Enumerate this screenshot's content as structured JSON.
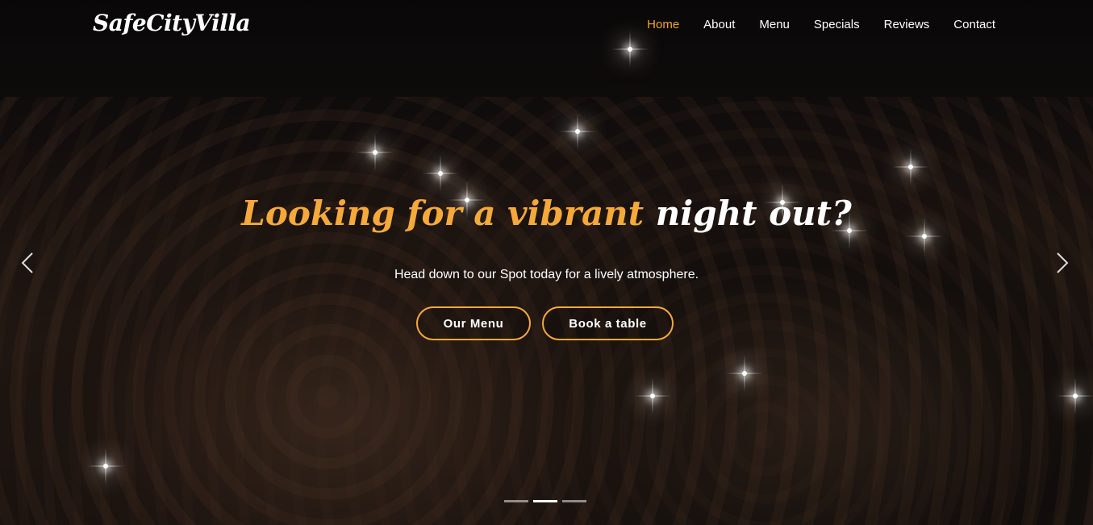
{
  "brand": {
    "logo_text": "SafeCityVilla"
  },
  "nav": {
    "items": [
      {
        "label": "Home",
        "active": true
      },
      {
        "label": "About"
      },
      {
        "label": "Menu"
      },
      {
        "label": "Specials"
      },
      {
        "label": "Reviews"
      },
      {
        "label": "Contact"
      }
    ]
  },
  "hero": {
    "headline_accent": "Looking for a vibrant",
    "headline_plain": "night out?",
    "subtitle": "Head down to our Spot today for a lively atmosphere.",
    "buttons": {
      "menu_label": "Our Menu",
      "book_label": "Book a table"
    },
    "carousel": {
      "slide_count": 3,
      "active_index": 1
    }
  },
  "colors": {
    "accent": "#f5a93a",
    "nav_active": "#f5a623",
    "text": "#ffffff"
  },
  "icons": {
    "prev": "chevron-left-icon",
    "next": "chevron-right-icon"
  }
}
